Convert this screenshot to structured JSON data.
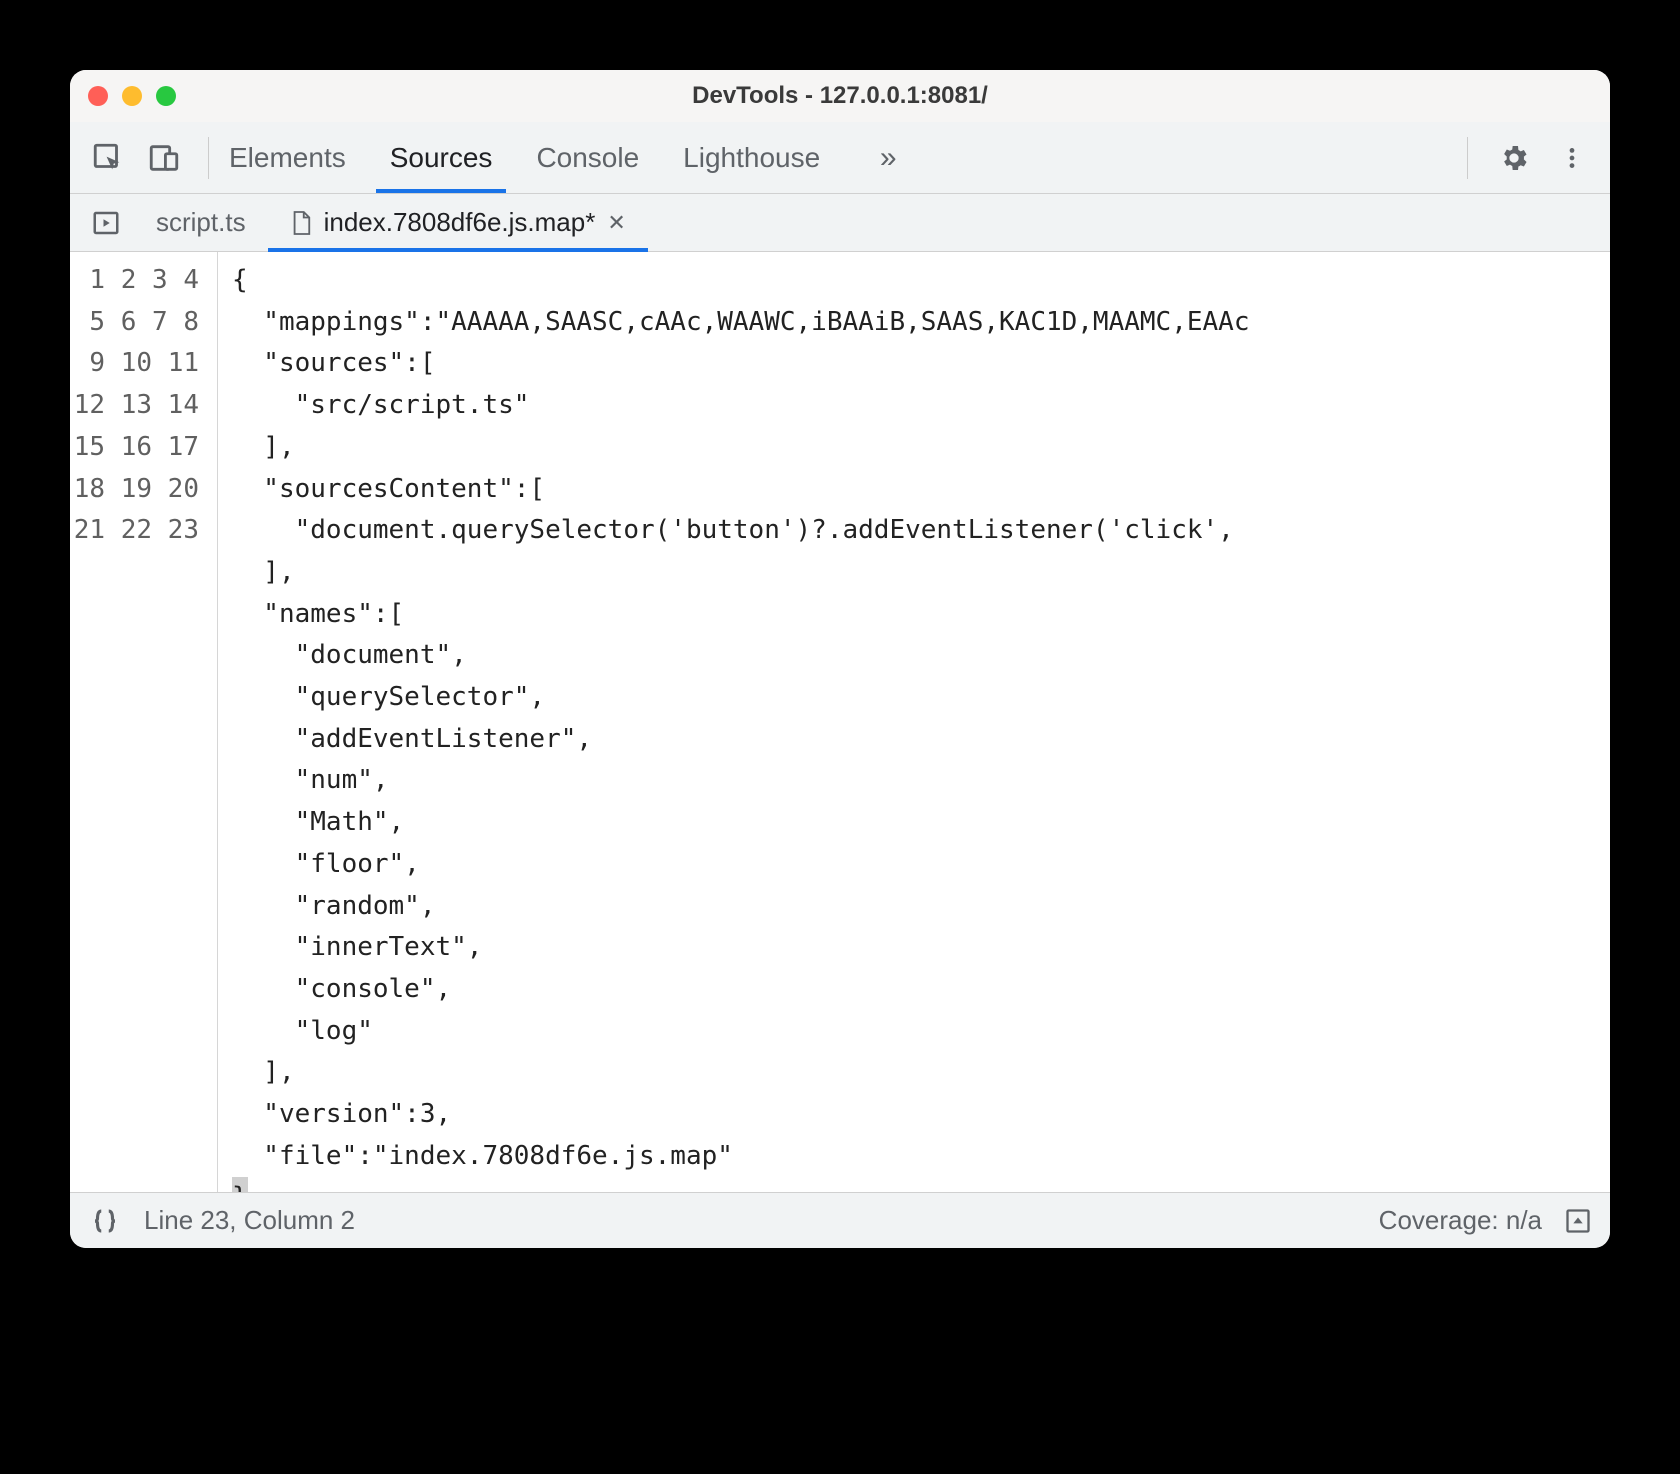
{
  "window": {
    "title": "DevTools - 127.0.0.1:8081/"
  },
  "panels": {
    "elements": "Elements",
    "sources": "Sources",
    "console": "Console",
    "lighthouse": "Lighthouse"
  },
  "file_tabs": {
    "tab1": "script.ts",
    "tab2": "index.7808df6e.js.map*"
  },
  "editor": {
    "lines": [
      "{",
      "  \"mappings\":\"AAAAA,SAASC,cAAc,WAAWC,iBAAiB,SAAS,KAC1D,MAAMC,EAAc",
      "  \"sources\":[",
      "    \"src/script.ts\"",
      "  ],",
      "  \"sourcesContent\":[",
      "    \"document.querySelector('button')?.addEventListener('click',",
      "  ],",
      "  \"names\":[",
      "    \"document\",",
      "    \"querySelector\",",
      "    \"addEventListener\",",
      "    \"num\",",
      "    \"Math\",",
      "    \"floor\",",
      "    \"random\",",
      "    \"innerText\",",
      "    \"console\",",
      "    \"log\"",
      "  ],",
      "  \"version\":3,",
      "  \"file\":\"index.7808df6e.js.map\"",
      "}"
    ]
  },
  "statusbar": {
    "position": "Line 23, Column 2",
    "coverage": "Coverage: n/a"
  }
}
